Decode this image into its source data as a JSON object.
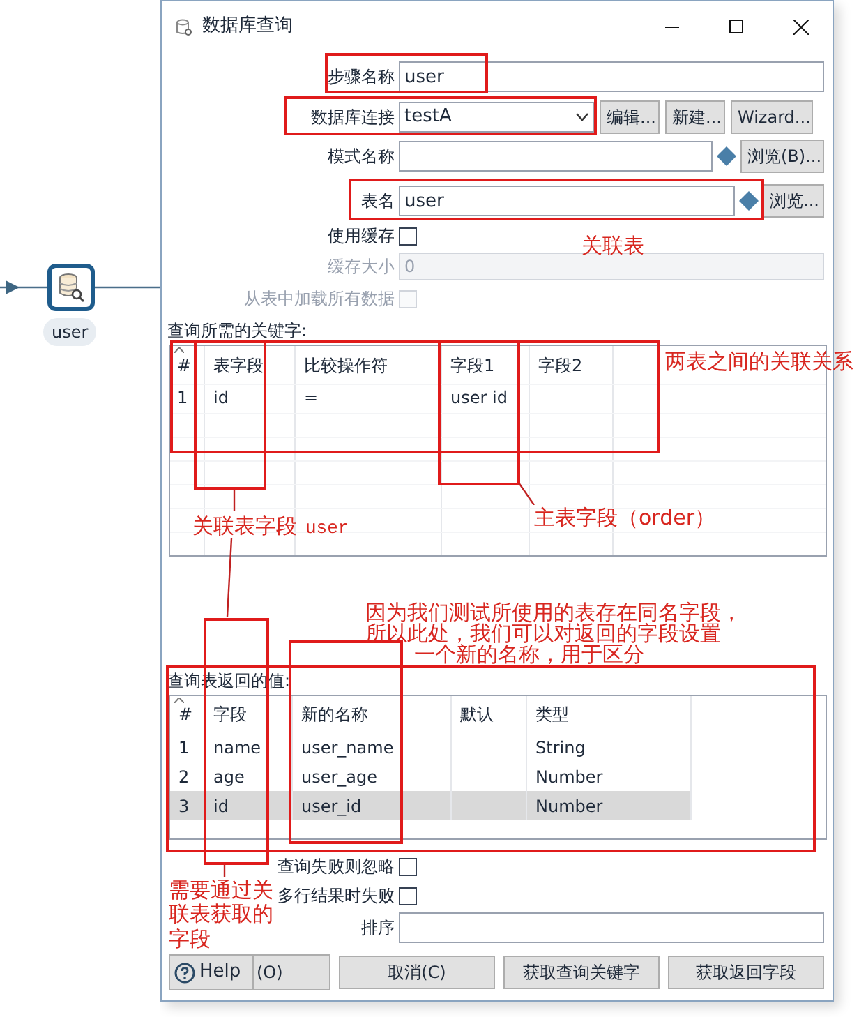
{
  "canvas": {
    "node": {
      "label": "user"
    }
  },
  "window": {
    "title": "数据库查询"
  },
  "step_name": {
    "label": "步骤名称",
    "value": "user"
  },
  "connection": {
    "label": "数据库连接",
    "value": "testA",
    "buttons": [
      "编辑...",
      "新建...",
      "Wizard..."
    ]
  },
  "schema": {
    "label": "模式名称",
    "button": "浏览(B)..."
  },
  "table_name": {
    "label": "表名",
    "value": "user",
    "button": "浏览..."
  },
  "use_cache": {
    "label": "使用缓存",
    "checked": false
  },
  "cache_size": {
    "label": "缓存大小",
    "value": "0",
    "disabled": true
  },
  "load_all": {
    "label": "从表中加载所有数据",
    "checked": false,
    "disabled": true
  },
  "keys_table": {
    "title": "查询所需的关键字:",
    "columns": [
      "#",
      "表字段",
      "比较操作符",
      "字段1",
      "字段2"
    ],
    "rows": [
      {
        "index": "1",
        "table_field": "id",
        "operator": "=",
        "field1": "user id"
      }
    ]
  },
  "returns_table": {
    "title": "查询表返回的值:",
    "columns": [
      "#",
      "字段",
      "新的名称",
      "默认",
      "类型"
    ],
    "rows": [
      {
        "index": "1",
        "field": "name",
        "new_name": "user_name",
        "type": "String",
        "selected": false
      },
      {
        "index": "2",
        "field": "age",
        "new_name": "user_age",
        "type": "Number",
        "selected": false
      },
      {
        "index": "3",
        "field": "id",
        "new_name": "user_id",
        "type": "Number",
        "selected": true
      }
    ]
  },
  "fail_ignore": {
    "label": "查询失败则忽略",
    "checked": false
  },
  "multi_fail": {
    "label": "多行结果时失败",
    "checked": false
  },
  "order_by": {
    "label": "排序"
  },
  "buttons": {
    "help": "Help",
    "ok": "(O)",
    "cancel": "取消(C)",
    "get_keys": "获取查询关键字",
    "get_fields": "获取返回字段"
  },
  "annotations": [
    "关联表",
    "两表之间的关联关系",
    "关联表字段",
    "user",
    "主表字段（order）",
    "因为我们测试所使用的表存在同名字段，",
    "所以此处，我们可以对返回的字段设置",
    "一个新的名称，用于区分",
    "需要通过关联表获取的",
    "字段"
  ]
}
